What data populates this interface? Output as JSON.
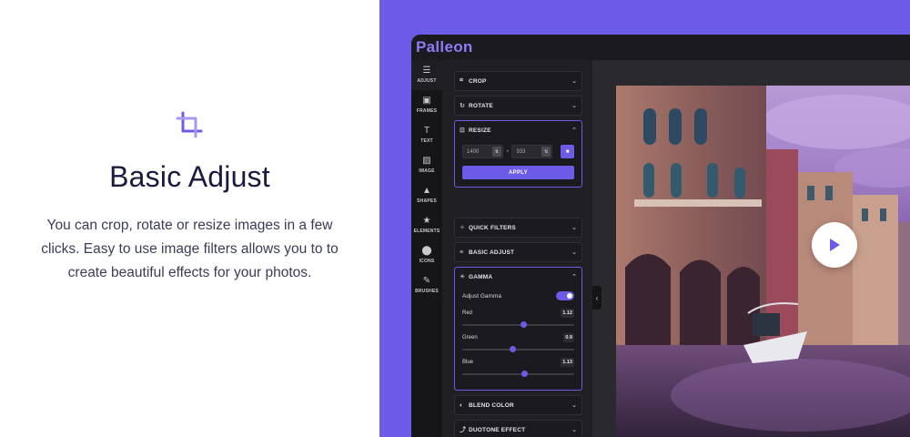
{
  "feature": {
    "title": "Basic Adjust",
    "description": "You can crop, rotate or resize images in a few clicks. Easy to use image filters allows you to to create beautiful effects for your photos.",
    "icon": "crop-icon",
    "accent": "#6c5be6"
  },
  "app": {
    "logo": "Palleon",
    "rail": [
      {
        "label": "ADJUST",
        "icon": "sliders-icon",
        "glyph": "☰"
      },
      {
        "label": "FRAMES",
        "icon": "frames-icon",
        "glyph": "▣"
      },
      {
        "label": "TEXT",
        "icon": "text-icon",
        "glyph": "T"
      },
      {
        "label": "IMAGE",
        "icon": "image-icon",
        "glyph": "▨"
      },
      {
        "label": "SHAPES",
        "icon": "shapes-icon",
        "glyph": "▲"
      },
      {
        "label": "ELEMENTS",
        "icon": "star-icon",
        "glyph": "★"
      },
      {
        "label": "ICONS",
        "icon": "pin-icon",
        "glyph": "⬤"
      },
      {
        "label": "BRUSHES",
        "icon": "brush-icon",
        "glyph": "✎"
      }
    ],
    "sections": {
      "crop": {
        "label": "CROP",
        "icon": "⌗"
      },
      "rotate": {
        "label": "ROTATE",
        "icon": "↻"
      },
      "resize": {
        "label": "RESIZE",
        "icon": "⊡"
      },
      "quick_filters": {
        "label": "QUICK FILTERS",
        "icon": "✧"
      },
      "basic_adjust": {
        "label": "BASIC ADJUST",
        "icon": "≡"
      },
      "gamma": {
        "label": "GAMMA",
        "icon": "☀"
      },
      "blend_color": {
        "label": "BLEND COLOR",
        "icon": "◐"
      },
      "duotone": {
        "label": "DUOTONE EFFECT",
        "icon": "⤴"
      }
    },
    "resize": {
      "width": "1400",
      "height": "933",
      "times": "×",
      "apply_label": "APPLY"
    },
    "gamma": {
      "toggle_label": "Adjust Gamma",
      "toggle_on": true,
      "sliders": [
        {
          "label": "Red",
          "value": "1.12",
          "fraction": 0.55
        },
        {
          "label": "Green",
          "value": "0.9",
          "fraction": 0.45
        },
        {
          "label": "Blue",
          "value": "1.13",
          "fraction": 0.56
        }
      ]
    }
  }
}
